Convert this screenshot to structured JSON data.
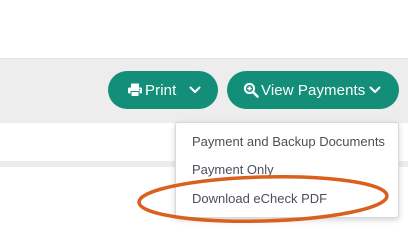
{
  "toolbar": {
    "print_label": "Print",
    "view_payments_label": "View Payments"
  },
  "icons": {
    "print": "printer-icon",
    "view_payments": "search-plus-icon",
    "caret": "chevron-down-icon"
  },
  "dropdown": {
    "items": [
      {
        "label": "Payment and Backup Documents"
      },
      {
        "label": "Payment Only"
      },
      {
        "label": "Download eCheck PDF"
      }
    ]
  },
  "colors": {
    "button": "#138f79",
    "annotation": "#d9601e",
    "menu_text": "#4b5058"
  }
}
